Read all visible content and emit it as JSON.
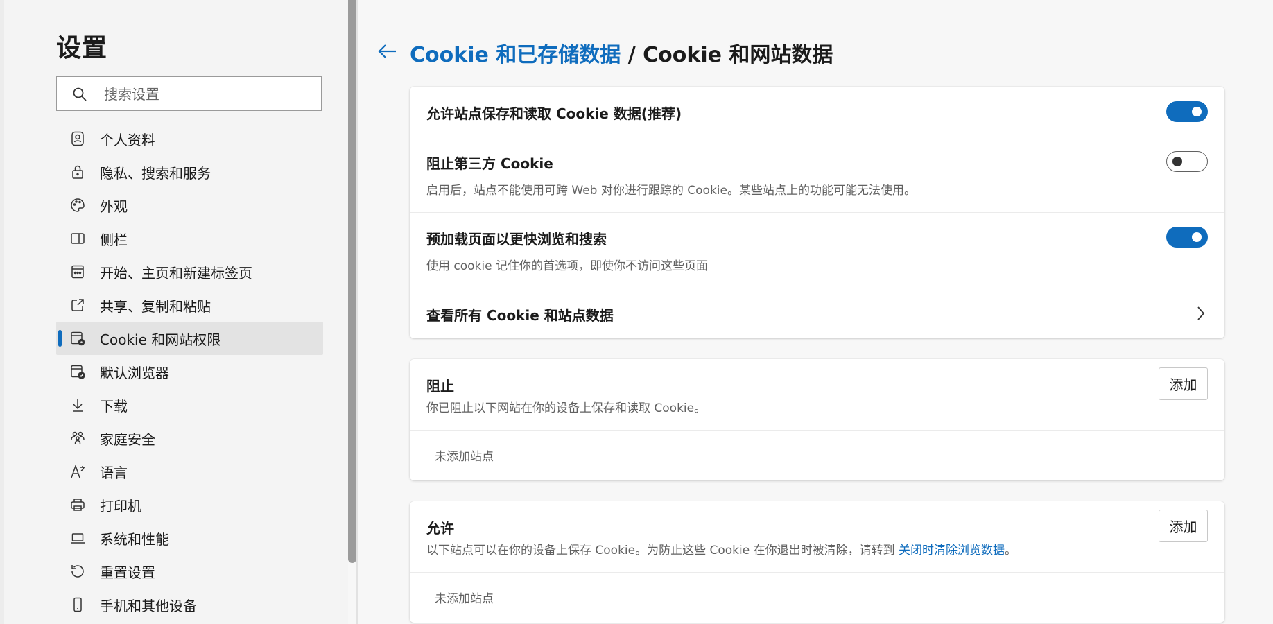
{
  "sidebar": {
    "title": "设置",
    "search": {
      "placeholder": "搜索设置"
    },
    "items": [
      {
        "label": "个人资料",
        "icon": "profile-icon"
      },
      {
        "label": "隐私、搜索和服务",
        "icon": "lock-icon"
      },
      {
        "label": "外观",
        "icon": "palette-icon"
      },
      {
        "label": "侧栏",
        "icon": "sidebar-icon"
      },
      {
        "label": "开始、主页和新建标签页",
        "icon": "home-icon"
      },
      {
        "label": "共享、复制和粘贴",
        "icon": "share-icon"
      },
      {
        "label": "Cookie 和网站权限",
        "icon": "cookie-settings-icon",
        "active": true
      },
      {
        "label": "默认浏览器",
        "icon": "default-browser-icon"
      },
      {
        "label": "下载",
        "icon": "download-icon"
      },
      {
        "label": "家庭安全",
        "icon": "family-icon"
      },
      {
        "label": "语言",
        "icon": "language-icon"
      },
      {
        "label": "打印机",
        "icon": "printer-icon"
      },
      {
        "label": "系统和性能",
        "icon": "laptop-icon"
      },
      {
        "label": "重置设置",
        "icon": "reset-icon"
      },
      {
        "label": "手机和其他设备",
        "icon": "phone-icon"
      }
    ]
  },
  "header": {
    "breadcrumb_parent": "Cookie 和已存储数据",
    "separator": "/",
    "breadcrumb_current": "Cookie 和网站数据"
  },
  "cookie_settings": {
    "allow_cookies": {
      "title": "允许站点保存和读取 Cookie 数据(推荐)",
      "enabled": true
    },
    "block_third_party": {
      "title": "阻止第三方 Cookie",
      "description": "启用后，站点不能使用可跨 Web 对你进行跟踪的 Cookie。某些站点上的功能可能无法使用。",
      "enabled": false
    },
    "preload_pages": {
      "title": "预加载页面以更快浏览和搜索",
      "description": "使用 cookie 记住你的首选项，即使你不访问这些页面",
      "enabled": true
    },
    "view_all": {
      "title": "查看所有 Cookie 和站点数据"
    }
  },
  "block_section": {
    "title": "阻止",
    "description": "你已阻止以下网站在你的设备上保存和读取 Cookie。",
    "add_label": "添加",
    "empty_text": "未添加站点"
  },
  "allow_section": {
    "title": "允许",
    "description_before": "以下站点可以在你的设备上保存 Cookie。为防止这些 Cookie 在你退出时被清除，请转到 ",
    "link_text": "关闭时清除浏览数据",
    "description_after": "。",
    "add_label": "添加",
    "empty_text": "未添加站点"
  },
  "colors": {
    "accent": "#0f6cbd",
    "toggle_off_border": "#616161",
    "text_secondary": "#616161"
  }
}
